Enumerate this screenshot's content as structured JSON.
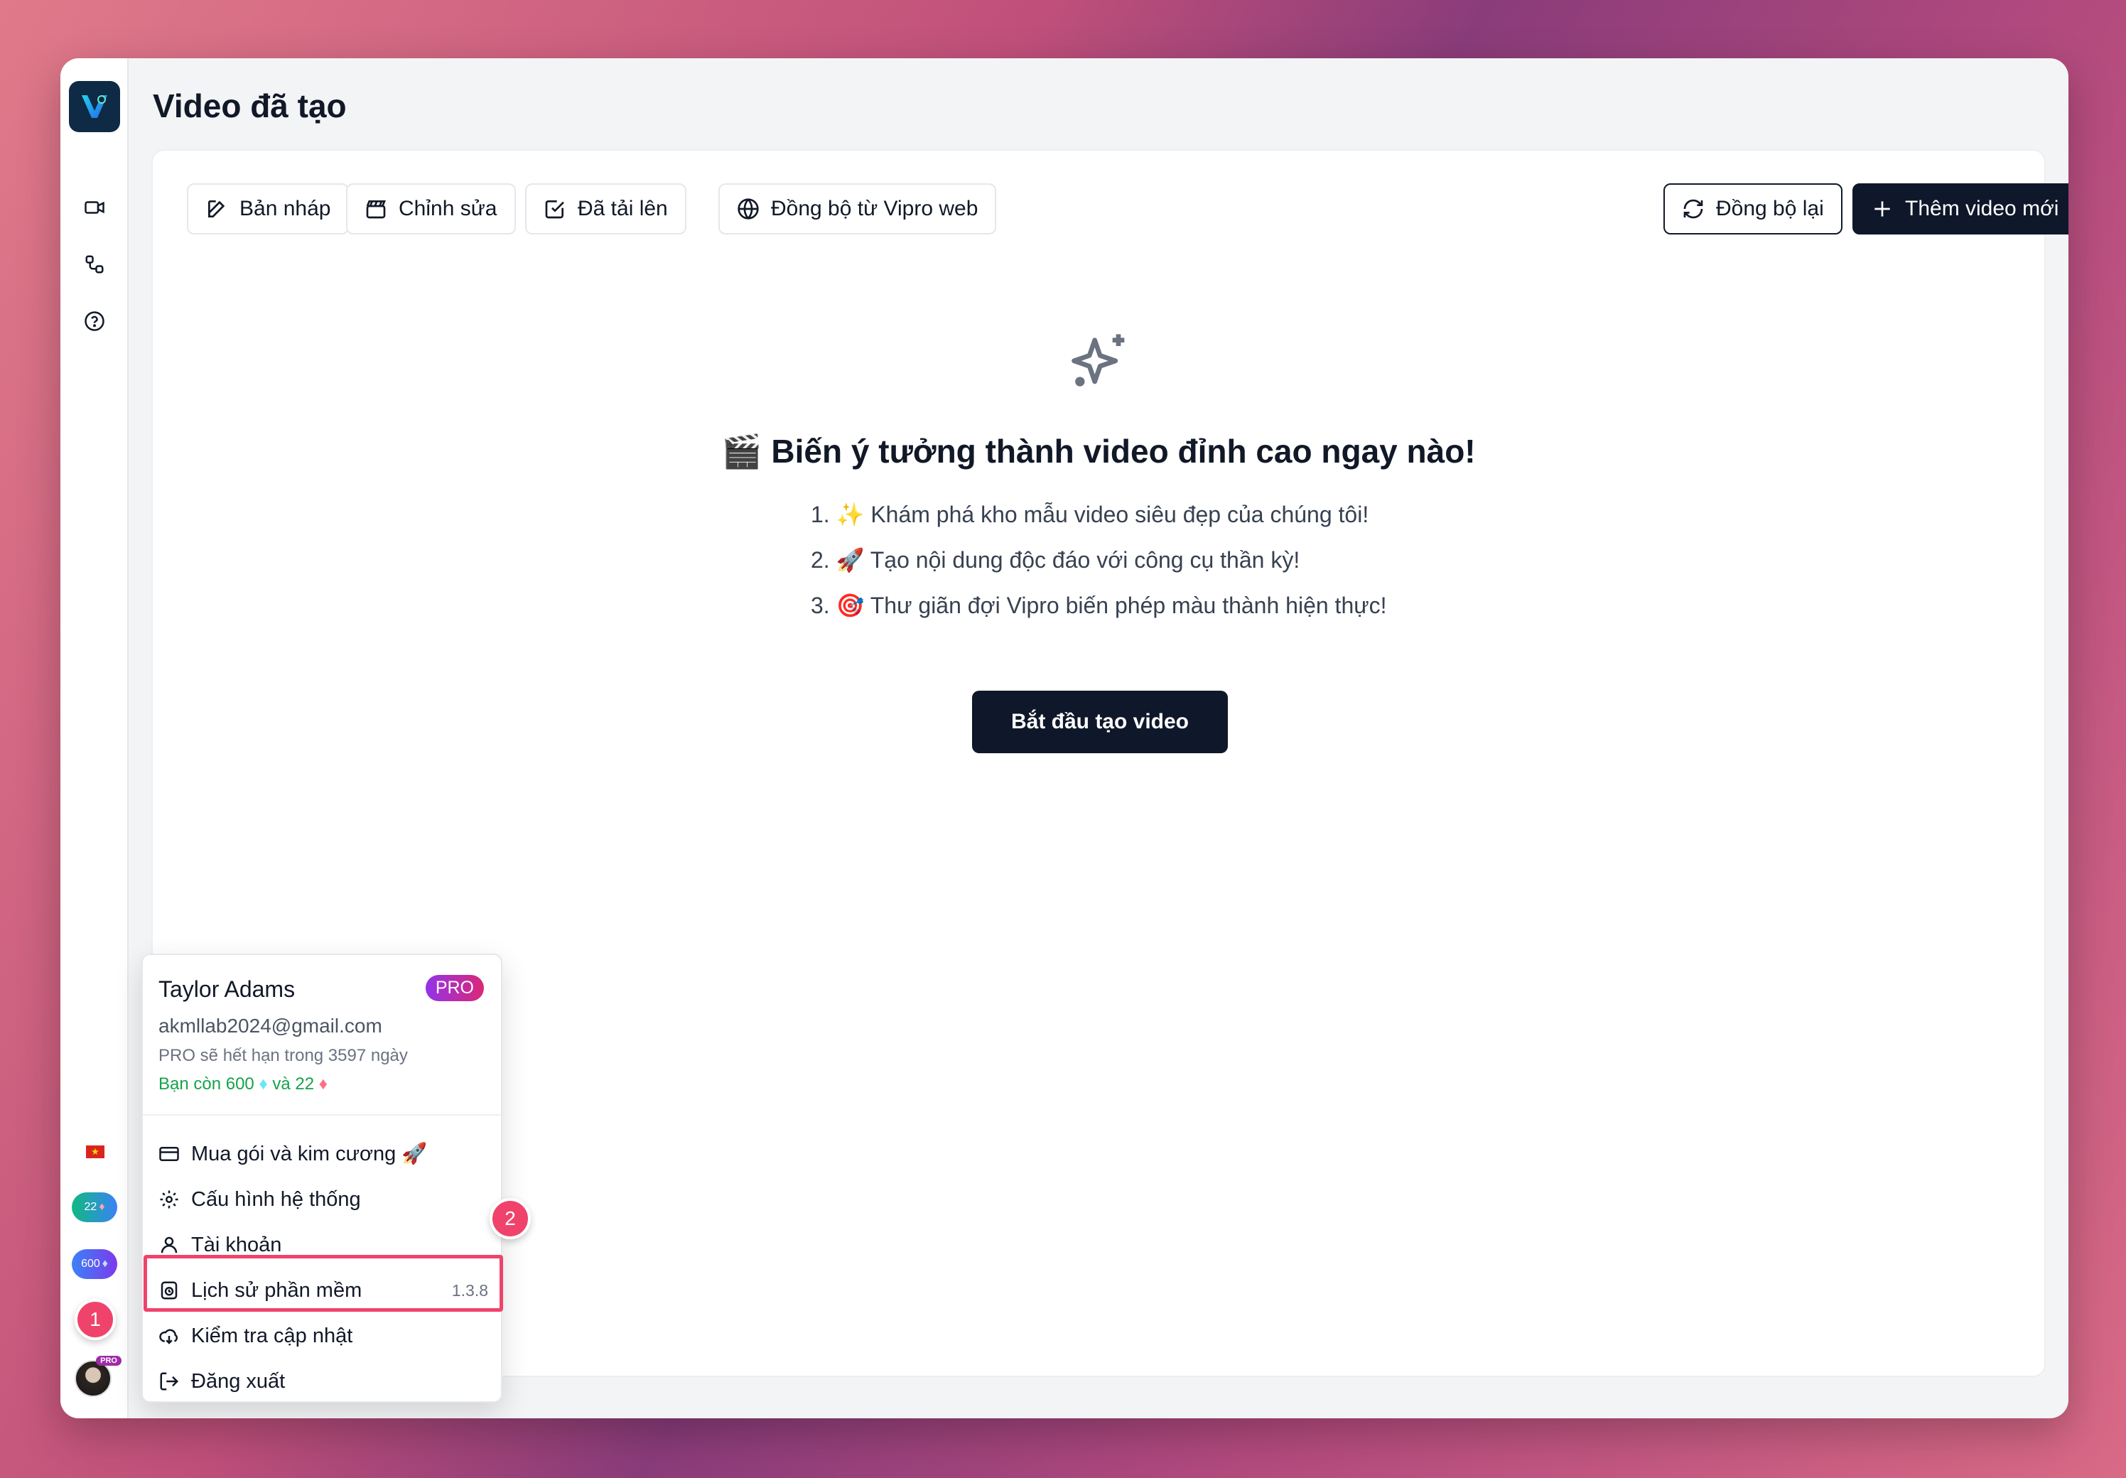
{
  "page": {
    "title": "Video đã tạo"
  },
  "toolbar": {
    "draft": "Bản nháp",
    "edit": "Chỉnh sửa",
    "uploaded": "Đã tải lên",
    "sync_web": "Đồng bộ từ Vipro web",
    "resync": "Đồng bộ lại",
    "add_video": "Thêm video mới"
  },
  "empty_state": {
    "headline": "🎬 Biến ý tưởng thành video đỉnh cao ngay nào!",
    "steps": [
      "1. ✨ Khám phá kho mẫu video siêu đẹp của chúng tôi!",
      "2. 🚀 Tạo nội dung độc đáo với công cụ thần kỳ!",
      "3. 🎯 Thư giãn đợi Vipro biến phép màu thành hiện thực!"
    ],
    "start_button": "Bắt đầu tạo video"
  },
  "sidebar": {
    "diamond_pink": "22",
    "diamond_blue": "600",
    "avatar_badge": "PRO"
  },
  "markers": {
    "one": "1",
    "two": "2"
  },
  "user_menu": {
    "name": "Taylor Adams",
    "badge": "PRO",
    "email": "akmllab2024@gmail.com",
    "expiry": "PRO sẽ hết hạn trong 3597 ngày",
    "balance_prefix": "Bạn còn 600",
    "balance_mid": "và 22",
    "items": [
      {
        "label": "Mua gói và kim cương 🚀",
        "icon": "credit-card-icon"
      },
      {
        "label": "Cấu hình hệ thống",
        "icon": "gear-icon"
      },
      {
        "label": "Tài khoản",
        "icon": "user-icon"
      },
      {
        "label": "Lịch sử phần mềm",
        "icon": "history-icon",
        "version": "1.3.8"
      },
      {
        "label": "Kiểm tra cập nhật",
        "icon": "cloud-sync-icon"
      },
      {
        "label": "Đăng xuất",
        "icon": "logout-icon"
      }
    ]
  },
  "colors": {
    "accent_dark": "#0f172a",
    "highlight": "#f0436b",
    "pro_badge": "#c026d3",
    "balance": "#16a34a"
  }
}
